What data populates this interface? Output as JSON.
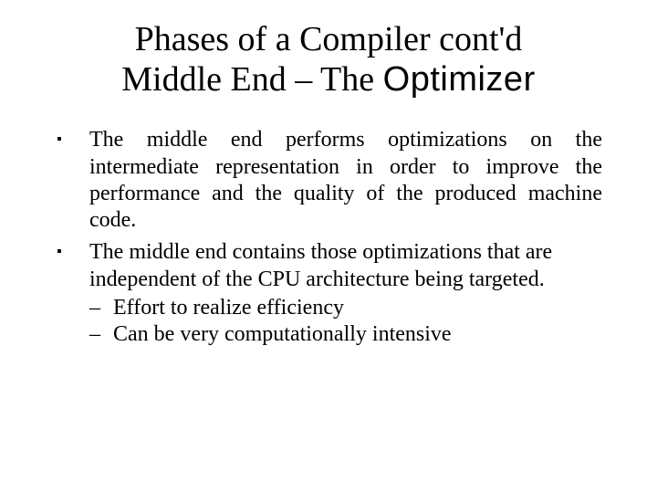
{
  "title": {
    "line1": "Phases of a Compiler cont'd",
    "line2_prefix": "Middle End – The ",
    "line2_em": "Optimizer"
  },
  "bullets": [
    {
      "text": "The middle end performs optimizations on the intermediate representation in order to improve the performance and the quality of the produced machine code.",
      "justify": true,
      "subs": []
    },
    {
      "text": "The middle end contains those optimizations that are independent of the CPU architecture being targeted.",
      "justify": false,
      "subs": [
        "Effort to realize efficiency",
        "Can be very computationally intensive"
      ]
    }
  ]
}
